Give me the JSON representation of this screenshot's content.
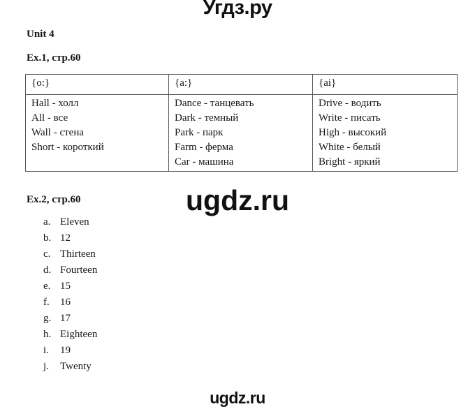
{
  "watermarks": {
    "top": "Угдз.ру",
    "center": "ugdz.ru",
    "bottom": "ugdz.ru"
  },
  "headings": {
    "unit": "Unit 4",
    "ex1": "Ex.1, стр.60",
    "ex2": "Ex.2, стр.60"
  },
  "table": {
    "headers": [
      "{o:}",
      "{a:}",
      "{ai}"
    ],
    "columns": [
      [
        "Hall  - холл",
        "All - все",
        "Wall - стена",
        "Short  - короткий"
      ],
      [
        "Dance  - танцевать",
        "Dark - темный",
        "Park - парк",
        "Farm - ферма",
        "Car  - машина"
      ],
      [
        "Drive  - водить",
        "Write - писать",
        "High - высокий",
        "White - белый",
        "Bright  - яркий"
      ]
    ]
  },
  "answers": [
    {
      "marker": "a.",
      "text": "Eleven"
    },
    {
      "marker": "b.",
      "text": "12"
    },
    {
      "marker": "c.",
      "text": "Thirteen"
    },
    {
      "marker": "d.",
      "text": "Fourteen"
    },
    {
      "marker": "e.",
      "text": "15"
    },
    {
      "marker": "f.",
      "text": "16"
    },
    {
      "marker": "g.",
      "text": "17"
    },
    {
      "marker": "h.",
      "text": "Eighteen"
    },
    {
      "marker": "i.",
      "text": "19"
    },
    {
      "marker": "j.",
      "text": "Twenty"
    }
  ],
  "colors": {
    "page_background": "#ffffff",
    "text": "#171717",
    "table_border": "#555555",
    "watermark": "#111111"
  }
}
